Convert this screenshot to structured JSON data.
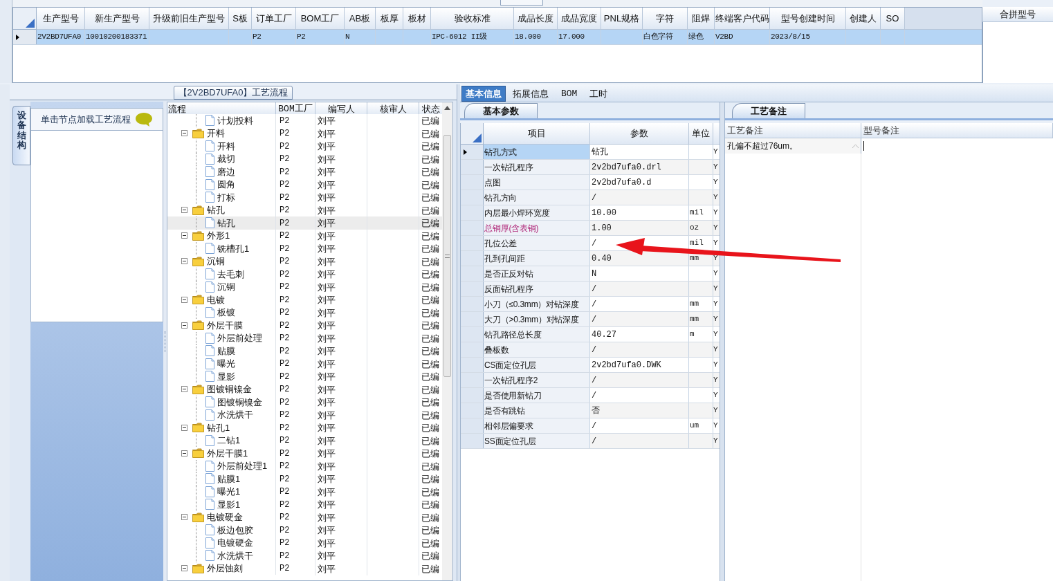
{
  "top_grid": {
    "columns": [
      "生产型号",
      "新生产型号",
      "升级前旧生产型号",
      "S板",
      "订单工厂",
      "BOM工厂",
      "AB板",
      "板厚",
      "板材",
      "验收标准",
      "成品长度",
      "成品宽度",
      "PNL规格",
      "字符",
      "阻焊",
      "终端客户代码",
      "型号创建时间",
      "创建人",
      "SO"
    ],
    "rows": [
      {
        "selected": true,
        "cells": [
          "2V2BD7UFA0",
          "10010200183371",
          null,
          null,
          "P2",
          "P2",
          "N",
          null,
          null,
          "IPC-6012 II级",
          "18.000",
          "17.000",
          null,
          "白色字符",
          "绿色",
          "V2BD",
          "2023/8/15",
          null,
          null
        ]
      }
    ]
  },
  "merge_panel": {
    "header": "合拼型号"
  },
  "flow_panel": {
    "title": "【2V2BD7UFA0】工艺流程",
    "side_tab": "设备结构",
    "hint": "单击节点加载工艺流程",
    "tree": {
      "columns": [
        "流程",
        "BOM工厂",
        "编写人",
        "核审人",
        "状态"
      ],
      "nodes": [
        {
          "kind": "file",
          "name": "计划投料",
          "bom": "P2",
          "author": "刘平",
          "status": "已编",
          "selected": false
        },
        {
          "kind": "folder",
          "name": "开料",
          "bom": "P2",
          "author": "刘平",
          "status": "已编",
          "selected": false,
          "expanded": true,
          "children": [
            {
              "kind": "file",
              "name": "开料",
              "bom": "P2",
              "author": "刘平",
              "status": "已编",
              "selected": false
            },
            {
              "kind": "file",
              "name": "裁切",
              "bom": "P2",
              "author": "刘平",
              "status": "已编",
              "selected": false
            },
            {
              "kind": "file",
              "name": "磨边",
              "bom": "P2",
              "author": "刘平",
              "status": "已编",
              "selected": false
            },
            {
              "kind": "file",
              "name": "圆角",
              "bom": "P2",
              "author": "刘平",
              "status": "已编",
              "selected": false
            },
            {
              "kind": "file",
              "name": "打标",
              "bom": "P2",
              "author": "刘平",
              "status": "已编",
              "selected": false
            }
          ]
        },
        {
          "kind": "folder",
          "name": "钻孔",
          "bom": "P2",
          "author": "刘平",
          "status": "已编",
          "selected": false,
          "expanded": true,
          "children": [
            {
              "kind": "file",
              "name": "钻孔",
              "bom": "P2",
              "author": "刘平",
              "status": "已编",
              "selected": true
            }
          ]
        },
        {
          "kind": "folder",
          "name": "外形1",
          "bom": "P2",
          "author": "刘平",
          "status": "已编",
          "selected": false,
          "expanded": true,
          "children": [
            {
              "kind": "file",
              "name": "铣槽孔1",
              "bom": "P2",
              "author": "刘平",
              "status": "已编",
              "selected": false
            }
          ]
        },
        {
          "kind": "folder",
          "name": "沉铜",
          "bom": "P2",
          "author": "刘平",
          "status": "已编",
          "selected": false,
          "expanded": true,
          "children": [
            {
              "kind": "file",
              "name": "去毛刺",
              "bom": "P2",
              "author": "刘平",
              "status": "已编",
              "selected": false
            },
            {
              "kind": "file",
              "name": "沉铜",
              "bom": "P2",
              "author": "刘平",
              "status": "已编",
              "selected": false
            }
          ]
        },
        {
          "kind": "folder",
          "name": "电镀",
          "bom": "P2",
          "author": "刘平",
          "status": "已编",
          "selected": false,
          "expanded": true,
          "children": [
            {
              "kind": "file",
              "name": "板镀",
              "bom": "P2",
              "author": "刘平",
              "status": "已编",
              "selected": false
            }
          ]
        },
        {
          "kind": "folder",
          "name": "外层干膜",
          "bom": "P2",
          "author": "刘平",
          "status": "已编",
          "selected": false,
          "expanded": true,
          "children": [
            {
              "kind": "file",
              "name": "外层前处理",
              "bom": "P2",
              "author": "刘平",
              "status": "已编",
              "selected": false
            },
            {
              "kind": "file",
              "name": "贴膜",
              "bom": "P2",
              "author": "刘平",
              "status": "已编",
              "selected": false
            },
            {
              "kind": "file",
              "name": "曝光",
              "bom": "P2",
              "author": "刘平",
              "status": "已编",
              "selected": false
            },
            {
              "kind": "file",
              "name": "显影",
              "bom": "P2",
              "author": "刘平",
              "status": "已编",
              "selected": false
            }
          ]
        },
        {
          "kind": "folder",
          "name": "图镀铜镍金",
          "bom": "P2",
          "author": "刘平",
          "status": "已编",
          "selected": false,
          "expanded": true,
          "children": [
            {
              "kind": "file",
              "name": "图镀铜镍金",
              "bom": "P2",
              "author": "刘平",
              "status": "已编",
              "selected": false
            },
            {
              "kind": "file",
              "name": "水洗烘干",
              "bom": "P2",
              "author": "刘平",
              "status": "已编",
              "selected": false
            }
          ]
        },
        {
          "kind": "folder",
          "name": "钻孔1",
          "bom": "P2",
          "author": "刘平",
          "status": "已编",
          "selected": false,
          "expanded": true,
          "children": [
            {
              "kind": "file",
              "name": "二钻1",
              "bom": "P2",
              "author": "刘平",
              "status": "已编",
              "selected": false
            }
          ]
        },
        {
          "kind": "folder",
          "name": "外层干膜1",
          "bom": "P2",
          "author": "刘平",
          "status": "已编",
          "selected": false,
          "expanded": true,
          "children": [
            {
              "kind": "file",
              "name": "外层前处理1",
              "bom": "P2",
              "author": "刘平",
              "status": "已编",
              "selected": false
            },
            {
              "kind": "file",
              "name": "贴膜1",
              "bom": "P2",
              "author": "刘平",
              "status": "已编",
              "selected": false
            },
            {
              "kind": "file",
              "name": "曝光1",
              "bom": "P2",
              "author": "刘平",
              "status": "已编",
              "selected": false
            },
            {
              "kind": "file",
              "name": "显影1",
              "bom": "P2",
              "author": "刘平",
              "status": "已编",
              "selected": false
            }
          ]
        },
        {
          "kind": "folder",
          "name": "电镀硬金",
          "bom": "P2",
          "author": "刘平",
          "status": "已编",
          "selected": false,
          "expanded": true,
          "children": [
            {
              "kind": "file",
              "name": "板边包胶",
              "bom": "P2",
              "author": "刘平",
              "status": "已编",
              "selected": false
            },
            {
              "kind": "file",
              "name": "电镀硬金",
              "bom": "P2",
              "author": "刘平",
              "status": "已编",
              "selected": false
            },
            {
              "kind": "file",
              "name": "水洗烘干",
              "bom": "P2",
              "author": "刘平",
              "status": "已编",
              "selected": false
            }
          ]
        },
        {
          "kind": "folder",
          "name": "外层蚀刻",
          "bom": "P2",
          "author": "刘平",
          "status": "已编",
          "selected": false,
          "expanded": true
        }
      ]
    }
  },
  "detail_tabs": [
    {
      "label": "基本信息",
      "selected": true
    },
    {
      "label": "拓展信息",
      "selected": false
    },
    {
      "label": "BOM",
      "selected": false
    },
    {
      "label": "工时",
      "selected": false
    }
  ],
  "params": {
    "tab": "基本参数",
    "columns": [
      "项目",
      "参数",
      "单位"
    ],
    "rows": [
      {
        "item": "钻孔方式",
        "value": "钻孔",
        "column_4": "Y",
        "selected": true,
        "highlighted": false
      },
      {
        "item": "一次钻孔程序",
        "value": "2v2bd7ufa0.drl",
        "column_4": "Y",
        "selected": false,
        "highlighted": false
      },
      {
        "item": "点图",
        "value": "2v2bd7ufa0.d",
        "column_4": "Y",
        "selected": false,
        "highlighted": false
      },
      {
        "item": "钻孔方向",
        "value": "/",
        "column_4": "Y",
        "selected": false,
        "highlighted": false
      },
      {
        "item": "内层最小焊环宽度",
        "value": "10.00",
        "unit": "mil",
        "column_4": "Y",
        "selected": false,
        "highlighted": false
      },
      {
        "item": "总铜厚(含表铜)",
        "value": "1.00",
        "unit": "oz",
        "column_4": "Y",
        "selected": false,
        "highlighted": true
      },
      {
        "item": "孔位公差",
        "value": "/",
        "unit": "mil",
        "column_4": "Y",
        "selected": false,
        "highlighted": false
      },
      {
        "item": "孔到孔间距",
        "value": "0.40",
        "unit": "mm",
        "column_4": "Y",
        "selected": false,
        "highlighted": false
      },
      {
        "item": "是否正反对钻",
        "value": "N",
        "column_4": "Y",
        "selected": false,
        "highlighted": false
      },
      {
        "item": "反面钻孔程序",
        "value": "/",
        "column_4": "Y",
        "selected": false,
        "highlighted": false
      },
      {
        "item": "小刀（≤0.3mm）对钻深度",
        "value": "/",
        "unit": "mm",
        "column_4": "Y",
        "selected": false,
        "highlighted": false
      },
      {
        "item": "大刀（>0.3mm）对钻深度",
        "value": "/",
        "unit": "mm",
        "column_4": "Y",
        "selected": false,
        "highlighted": false
      },
      {
        "item": "钻孔路径总长度",
        "value": "40.27",
        "unit": "m",
        "column_4": "Y",
        "selected": false,
        "highlighted": false
      },
      {
        "item": "叠板数",
        "value": "/",
        "column_4": "Y",
        "selected": false,
        "highlighted": false
      },
      {
        "item": "CS面定位孔层",
        "value": "2v2bd7ufa0.DWK",
        "column_4": "Y",
        "selected": false,
        "highlighted": false
      },
      {
        "item": "一次钻孔程序2",
        "value": "/",
        "column_4": "Y",
        "selected": false,
        "highlighted": false
      },
      {
        "item": "是否使用新钻刀",
        "value": "/",
        "column_4": "Y",
        "selected": false,
        "highlighted": false
      },
      {
        "item": "是否有跳钻",
        "value": "否",
        "column_4": "Y",
        "selected": false,
        "highlighted": false
      },
      {
        "item": "相邻层偏要求",
        "value": "/",
        "unit": "um",
        "column_4": "Y",
        "selected": false,
        "highlighted": false
      },
      {
        "item": "SS面定位孔层",
        "value": "/",
        "column_4": "Y",
        "selected": false,
        "highlighted": false
      }
    ]
  },
  "notes": {
    "tab": "工艺备注",
    "columns": [
      "工艺备注",
      "型号备注"
    ],
    "process_note": "孔偏不超过76um。"
  }
}
